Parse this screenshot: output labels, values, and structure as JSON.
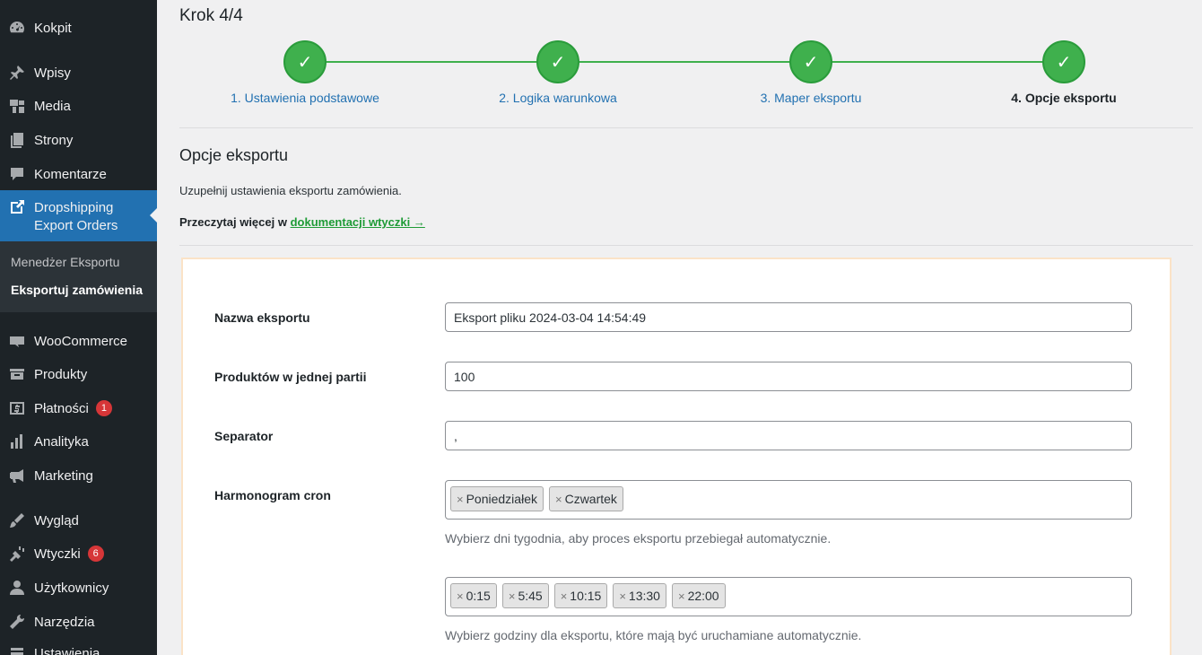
{
  "sidebar": {
    "items": [
      {
        "label": "Kokpit",
        "icon": "dashboard-icon"
      },
      {
        "label": "Wpisy",
        "icon": "pin-icon"
      },
      {
        "label": "Media",
        "icon": "media-icon"
      },
      {
        "label": "Strony",
        "icon": "pages-icon"
      },
      {
        "label": "Komentarze",
        "icon": "comments-icon"
      },
      {
        "label": "Dropshipping Export Orders",
        "icon": "external-link-icon"
      },
      {
        "label": "WooCommerce",
        "icon": "woo-icon"
      },
      {
        "label": "Produkty",
        "icon": "archive-icon"
      },
      {
        "label": "Płatności",
        "icon": "dollar-icon",
        "badge": "1"
      },
      {
        "label": "Analityka",
        "icon": "chart-bar-icon"
      },
      {
        "label": "Marketing",
        "icon": "megaphone-icon"
      },
      {
        "label": "Wygląd",
        "icon": "brush-icon"
      },
      {
        "label": "Wtyczki",
        "icon": "plugin-icon",
        "badge": "6"
      },
      {
        "label": "Użytkownicy",
        "icon": "users-icon"
      },
      {
        "label": "Narzędzia",
        "icon": "wrench-icon"
      },
      {
        "label": "Ustawienia",
        "icon": "settings-icon"
      }
    ],
    "active_line1": "Dropshipping",
    "active_line2": "Export Orders",
    "submenu": [
      "Menedżer Eksportu",
      "Eksportuj zamówienia"
    ]
  },
  "wizard": {
    "title": "Krok 4/4",
    "check": "✓",
    "steps": [
      "1. Ustawienia podstawowe",
      "2. Logika warunkowa",
      "3. Maper eksportu",
      "4. Opcje eksportu"
    ]
  },
  "section": {
    "title": "Opcje eksportu",
    "description": "Uzupełnij ustawienia eksportu zamówienia.",
    "readmore_prefix": "Przeczytaj więcej w",
    "readmore_link": "dokumentacji wtyczki →"
  },
  "form": {
    "name_label": "Nazwa eksportu",
    "name_value": "Eksport pliku 2024-03-04 14:54:49",
    "batch_label": "Produktów w jednej partii",
    "batch_value": "100",
    "separator_label": "Separator",
    "separator_value": ",",
    "cron_label": "Harmonogram cron",
    "days": [
      "Poniedziałek",
      "Czwartek"
    ],
    "days_help": "Wybierz dni tygodnia, aby proces eksportu przebiegał automatycznie.",
    "hours": [
      "0:15",
      "5:45",
      "10:15",
      "13:30",
      "22:00"
    ],
    "hours_help": "Wybierz godziny dla eksportu, które mają być uruchamiane automatycznie.",
    "tag_remove": "×"
  },
  "colors": {
    "accent": "#2271b1",
    "success": "#3fb04d",
    "sidebar": "#1d2327",
    "badge": "#d63638"
  }
}
